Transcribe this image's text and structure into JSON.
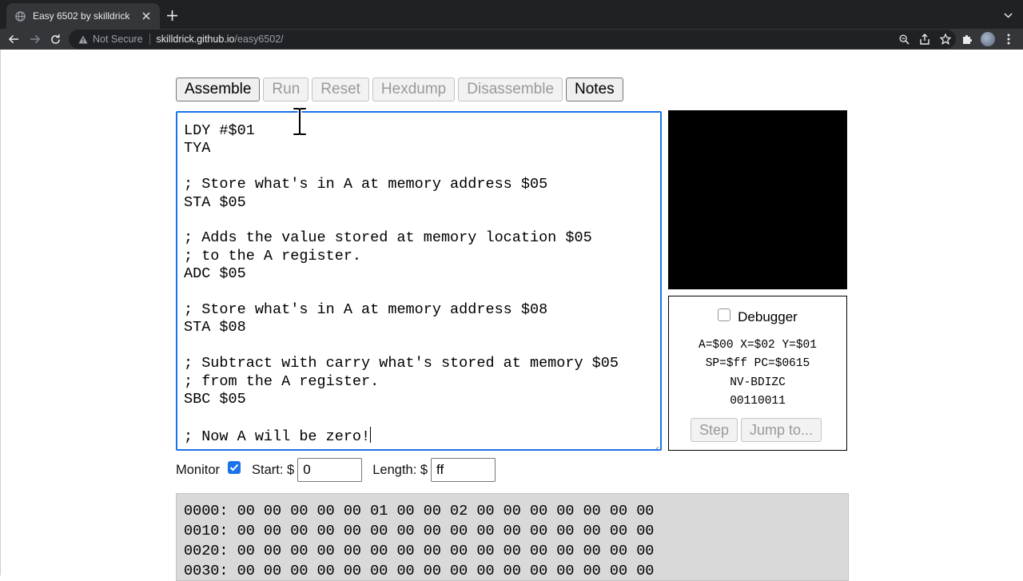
{
  "browser": {
    "tab_title": "Easy 6502 by skilldrick",
    "security_label": "Not Secure",
    "url_host": "skilldrick.github.io",
    "url_path": "/easy6502/"
  },
  "toolbar_buttons": [
    {
      "label": "Assemble",
      "enabled": true
    },
    {
      "label": "Run",
      "enabled": false
    },
    {
      "label": "Reset",
      "enabled": false
    },
    {
      "label": "Hexdump",
      "enabled": false
    },
    {
      "label": "Disassemble",
      "enabled": false
    },
    {
      "label": "Notes",
      "enabled": true
    }
  ],
  "editor": {
    "lines": [
      "LDY #$01",
      "TYA",
      "",
      "; Store what's in A at memory address $05",
      "STA $05",
      "",
      "; Adds the value stored at memory location $05",
      "; to the A register.",
      "ADC $05",
      "",
      "; Store what's in A at memory address $08",
      "STA $08",
      "",
      "; Subtract with carry what's stored at memory $05",
      "; from the A register.",
      "SBC $05",
      "",
      "; Now A will be zero!"
    ]
  },
  "debugger": {
    "label": "Debugger",
    "checked": false,
    "regs_line1": "A=$00 X=$02 Y=$01",
    "regs_line2": "SP=$ff PC=$0615",
    "flags_header": "NV-BDIZC",
    "flags_bits": "00110011",
    "step_label": "Step",
    "jump_label": "Jump to..."
  },
  "monitor": {
    "label": "Monitor",
    "checked": true,
    "start_label": "Start: $",
    "start_value": "0",
    "length_label": "Length: $",
    "length_value": "ff"
  },
  "memory_lines": [
    "0000: 00 00 00 00 00 01 00 00 02 00 00 00 00 00 00 00",
    "0010: 00 00 00 00 00 00 00 00 00 00 00 00 00 00 00 00",
    "0020: 00 00 00 00 00 00 00 00 00 00 00 00 00 00 00 00",
    "0030: 00 00 00 00 00 00 00 00 00 00 00 00 00 00 00 00"
  ]
}
